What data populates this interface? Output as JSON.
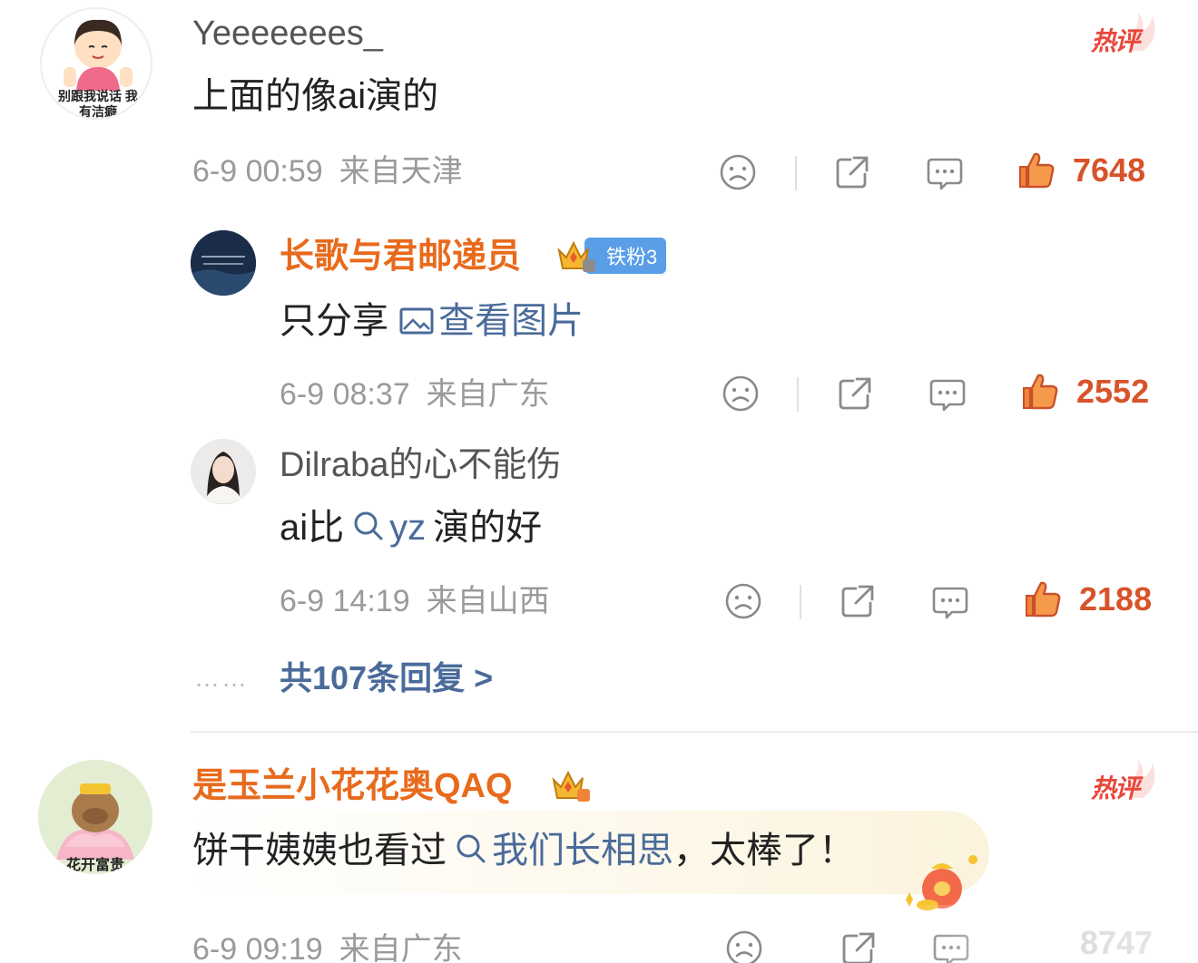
{
  "comments": [
    {
      "username": "Yeeeeeees_",
      "avatar_caption": "别跟我说话 我有洁癖",
      "hot_label": "热评",
      "content": "上面的像ai演的",
      "date": "6-9 00:59",
      "location": "来自天津",
      "likes": "7648",
      "replies": [
        {
          "username": "长歌与君邮递员",
          "fan_badge": "铁粉3",
          "content_prefix": "只分享 ",
          "content_link": "查看图片",
          "date": "6-9 08:37",
          "location": "来自广东",
          "likes": "2552"
        },
        {
          "username": "Dilraba的心不能伤",
          "content_prefix": "ai比",
          "content_link": "yz",
          "content_suffix": "演的好",
          "date": "6-9 14:19",
          "location": "来自山西",
          "likes": "2188"
        }
      ],
      "more_replies": "共107条回复 >",
      "dots": "……"
    },
    {
      "username": "是玉兰小花花奥QAQ",
      "avatar_caption": "花开富贵",
      "hot_label": "热评",
      "content_prefix": "饼干姨姨也看过",
      "content_link": "我们长相思",
      "content_suffix": "，太棒了！",
      "date": "6-9 09:19",
      "location": "来自广东",
      "likes": "8747"
    }
  ],
  "colors": {
    "username_highlight": "#e86a1c",
    "link": "#4a6b9a",
    "like": "#d8532a",
    "hot": "#e8473a",
    "meta": "#9a9a9a"
  },
  "icons": [
    "sad-face-icon",
    "share-icon",
    "comment-icon",
    "thumbs-up-icon",
    "search-icon",
    "image-icon",
    "crown-icon"
  ]
}
